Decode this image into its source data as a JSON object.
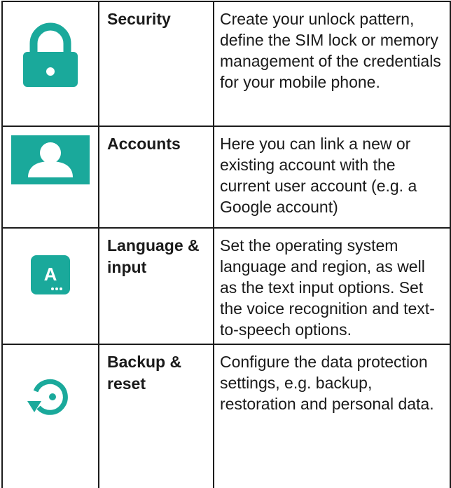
{
  "colors": {
    "icon_teal": "#1aa99b",
    "border": "#1c1c1c"
  },
  "rows": [
    {
      "icon": "lock-icon",
      "name": "Security",
      "description": "Create your unlock pattern, define the SIM lock or memory management of the credentials for your mobile phone."
    },
    {
      "icon": "account-person-icon",
      "name": "Accounts",
      "description": "Here you can link a new or existing account with the current user account (e.g. a Google account)"
    },
    {
      "icon": "language-input-icon",
      "icon_letter": "A",
      "name": "Language & input",
      "description": "Set the operating system language and region, as well as the text input options. Set the voice recognition and text-to-speech options."
    },
    {
      "icon": "backup-restore-icon",
      "name": "Backup & reset",
      "description": "Configure the data protection settings, e.g. backup, restoration and personal data."
    }
  ]
}
